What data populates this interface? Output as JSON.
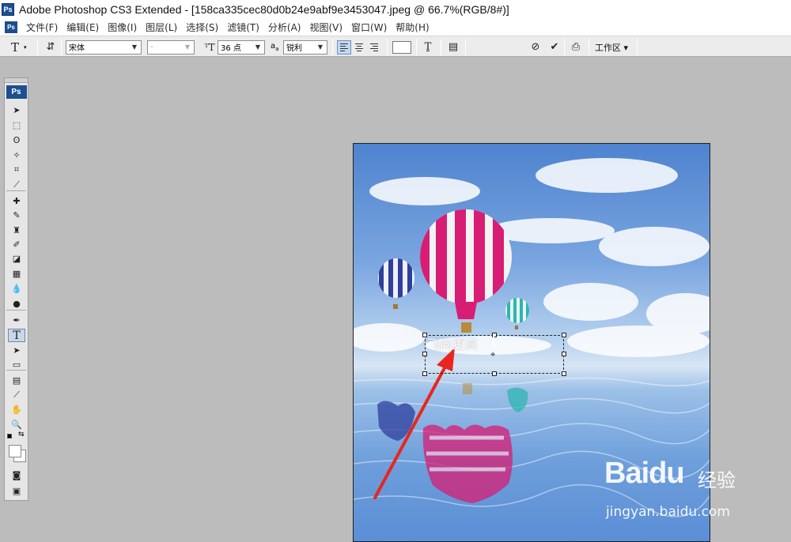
{
  "window": {
    "app_icon": "Ps",
    "title": "Adobe Photoshop CS3 Extended - [158ca335cec80d0b24e9abf9e3453047.jpeg @ 66.7%(RGB/8#)]"
  },
  "menubar": {
    "icon": "Ps",
    "items": [
      "文件(F)",
      "编辑(E)",
      "图像(I)",
      "图层(L)",
      "选择(S)",
      "滤镜(T)",
      "分析(A)",
      "视图(V)",
      "窗口(W)",
      "帮助(H)"
    ]
  },
  "options": {
    "tool_icon": "T",
    "font_family": "宋体",
    "font_style": "-",
    "font_size": "36 点",
    "antialias_prefix": "a",
    "antialias": "锐利",
    "alignment": "left",
    "text_color": "#ffffff",
    "workspace_label": "工作区 ▾"
  },
  "toolbox": {
    "logo": "Ps",
    "selected_tool": "type-tool",
    "tools": [
      {
        "name": "move-tool-icon",
        "glyph": "➤"
      },
      {
        "name": "marquee-tool-icon",
        "glyph": "⬚"
      },
      {
        "name": "lasso-tool-icon",
        "glyph": "ʘ"
      },
      {
        "name": "magic-wand-tool-icon",
        "glyph": "✧"
      },
      {
        "name": "crop-tool-icon",
        "glyph": "⌗"
      },
      {
        "name": "slice-tool-icon",
        "glyph": "⟋"
      },
      {
        "name": "healing-brush-tool-icon",
        "glyph": "✚"
      },
      {
        "name": "brush-tool-icon",
        "glyph": "✎"
      },
      {
        "name": "clone-stamp-tool-icon",
        "glyph": "♜"
      },
      {
        "name": "history-brush-tool-icon",
        "glyph": "✐"
      },
      {
        "name": "eraser-tool-icon",
        "glyph": "◪"
      },
      {
        "name": "gradient-tool-icon",
        "glyph": "▦"
      },
      {
        "name": "blur-tool-icon",
        "glyph": "💧"
      },
      {
        "name": "dodge-tool-icon",
        "glyph": "●"
      },
      {
        "name": "pen-tool-icon",
        "glyph": "✒"
      },
      {
        "name": "type-tool-icon",
        "glyph": "T"
      },
      {
        "name": "path-selection-tool-icon",
        "glyph": "➤"
      },
      {
        "name": "shape-tool-icon",
        "glyph": "▭"
      },
      {
        "name": "notes-tool-icon",
        "glyph": "▤"
      },
      {
        "name": "eyedropper-tool-icon",
        "glyph": "⟋"
      },
      {
        "name": "hand-tool-icon",
        "glyph": "✋"
      },
      {
        "name": "zoom-tool-icon",
        "glyph": "🔍"
      }
    ],
    "foreground_color": "#ffffff",
    "background_color": "#ffffff"
  },
  "canvas": {
    "typed_text": "飞向更高",
    "watermark_main": "Baidu",
    "watermark_cn": "经验",
    "watermark_url": "jingyan.baidu.com",
    "annotation_color": "#e8261e",
    "balloon_colors": [
      "#d81d74",
      "#2f3f9c",
      "#2db6b0"
    ]
  }
}
